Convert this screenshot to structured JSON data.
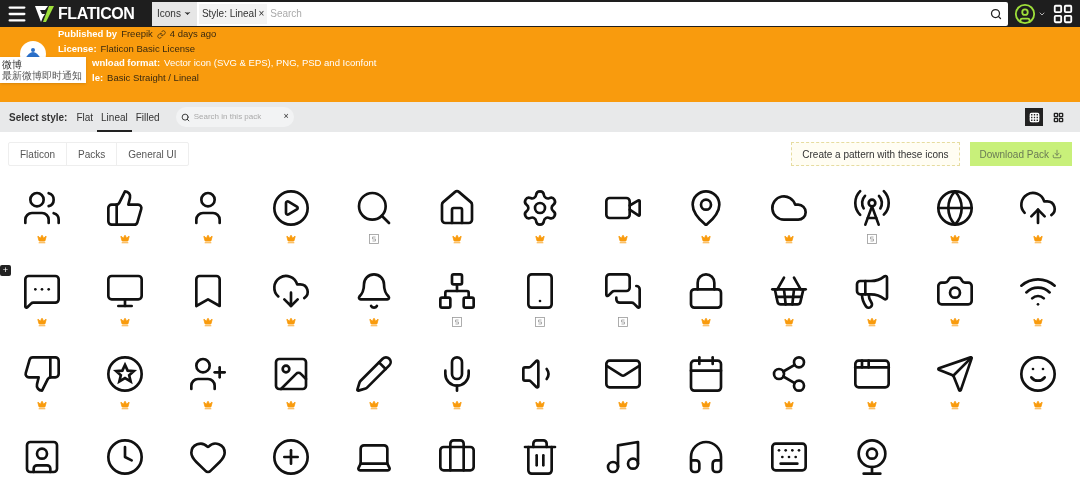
{
  "nav": {
    "logo": "FLATICON",
    "type_select": "Icons",
    "filter_chip": "Style: Lineal",
    "filter_close": "×",
    "search_placeholder": "Search"
  },
  "pack_info": {
    "published_label": "Published by",
    "published_author": "Freepik",
    "published_time": "4 days ago",
    "license_label": "License:",
    "license_value": "Flaticon Basic License",
    "format_label": "wnload format:",
    "format_value": "Vector icon (SVG & EPS), PNG, PSD and Iconfont",
    "style_label": "le:",
    "style_value": "Basic Straight / Lineal"
  },
  "notification": {
    "title": "微博",
    "body": "最新微博即时通知"
  },
  "style_bar": {
    "label": "Select style:",
    "styles": [
      {
        "label": "Flat",
        "selected": false
      },
      {
        "label": "Lineal",
        "selected": true
      },
      {
        "label": "Filled",
        "selected": false
      }
    ],
    "search_placeholder": "Search in this pack",
    "search_clear": "×",
    "views": [
      {
        "selected": true
      },
      {
        "selected": false
      }
    ]
  },
  "breadcrumb": [
    "Flaticon",
    "Packs",
    "General UI"
  ],
  "pattern_button": "Create a pattern with these icons",
  "download_button": "Download Pack",
  "side_button": "+",
  "icons": [
    {
      "kind": "premium"
    },
    {
      "kind": "premium"
    },
    {
      "kind": "premium"
    },
    {
      "kind": "premium"
    },
    {
      "kind": "selection"
    },
    {
      "kind": "premium"
    },
    {
      "kind": "premium"
    },
    {
      "kind": "premium"
    },
    {
      "kind": "premium"
    },
    {
      "kind": "premium"
    },
    {
      "kind": "selection"
    },
    {
      "kind": "premium"
    },
    {
      "kind": "premium"
    },
    {
      "kind": "premium"
    },
    {
      "kind": "premium"
    },
    {
      "kind": "premium"
    },
    {
      "kind": "premium"
    },
    {
      "kind": "premium"
    },
    {
      "kind": "selection"
    },
    {
      "kind": "selection"
    },
    {
      "kind": "selection"
    },
    {
      "kind": "premium"
    },
    {
      "kind": "premium"
    },
    {
      "kind": "premium"
    },
    {
      "kind": "premium"
    },
    {
      "kind": "premium"
    },
    {
      "kind": "premium"
    },
    {
      "kind": "premium"
    },
    {
      "kind": "premium"
    },
    {
      "kind": "premium"
    },
    {
      "kind": "premium"
    },
    {
      "kind": "premium"
    },
    {
      "kind": "premium"
    },
    {
      "kind": "premium"
    },
    {
      "kind": "premium"
    },
    {
      "kind": "premium"
    },
    {
      "kind": "premium"
    },
    {
      "kind": "premium"
    },
    {
      "kind": "premium"
    },
    {
      "kind": "plain"
    },
    {
      "kind": "plain"
    },
    {
      "kind": "plain"
    },
    {
      "kind": "plain"
    },
    {
      "kind": "plain"
    },
    {
      "kind": "plain"
    },
    {
      "kind": "plain"
    },
    {
      "kind": "plain"
    },
    {
      "kind": "plain"
    },
    {
      "kind": "plain"
    },
    {
      "kind": "plain"
    }
  ]
}
